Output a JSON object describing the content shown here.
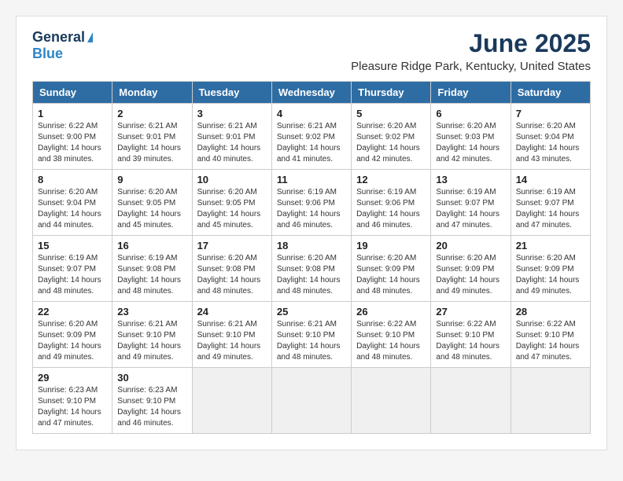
{
  "logo": {
    "general": "General",
    "blue": "Blue"
  },
  "title": "June 2025",
  "location": "Pleasure Ridge Park, Kentucky, United States",
  "days_of_week": [
    "Sunday",
    "Monday",
    "Tuesday",
    "Wednesday",
    "Thursday",
    "Friday",
    "Saturday"
  ],
  "weeks": [
    [
      {
        "day": "1",
        "sunrise": "6:22 AM",
        "sunset": "9:00 PM",
        "daylight": "14 hours and 38 minutes."
      },
      {
        "day": "2",
        "sunrise": "6:21 AM",
        "sunset": "9:01 PM",
        "daylight": "14 hours and 39 minutes."
      },
      {
        "day": "3",
        "sunrise": "6:21 AM",
        "sunset": "9:01 PM",
        "daylight": "14 hours and 40 minutes."
      },
      {
        "day": "4",
        "sunrise": "6:21 AM",
        "sunset": "9:02 PM",
        "daylight": "14 hours and 41 minutes."
      },
      {
        "day": "5",
        "sunrise": "6:20 AM",
        "sunset": "9:02 PM",
        "daylight": "14 hours and 42 minutes."
      },
      {
        "day": "6",
        "sunrise": "6:20 AM",
        "sunset": "9:03 PM",
        "daylight": "14 hours and 42 minutes."
      },
      {
        "day": "7",
        "sunrise": "6:20 AM",
        "sunset": "9:04 PM",
        "daylight": "14 hours and 43 minutes."
      }
    ],
    [
      {
        "day": "8",
        "sunrise": "6:20 AM",
        "sunset": "9:04 PM",
        "daylight": "14 hours and 44 minutes."
      },
      {
        "day": "9",
        "sunrise": "6:20 AM",
        "sunset": "9:05 PM",
        "daylight": "14 hours and 45 minutes."
      },
      {
        "day": "10",
        "sunrise": "6:20 AM",
        "sunset": "9:05 PM",
        "daylight": "14 hours and 45 minutes."
      },
      {
        "day": "11",
        "sunrise": "6:19 AM",
        "sunset": "9:06 PM",
        "daylight": "14 hours and 46 minutes."
      },
      {
        "day": "12",
        "sunrise": "6:19 AM",
        "sunset": "9:06 PM",
        "daylight": "14 hours and 46 minutes."
      },
      {
        "day": "13",
        "sunrise": "6:19 AM",
        "sunset": "9:07 PM",
        "daylight": "14 hours and 47 minutes."
      },
      {
        "day": "14",
        "sunrise": "6:19 AM",
        "sunset": "9:07 PM",
        "daylight": "14 hours and 47 minutes."
      }
    ],
    [
      {
        "day": "15",
        "sunrise": "6:19 AM",
        "sunset": "9:07 PM",
        "daylight": "14 hours and 48 minutes."
      },
      {
        "day": "16",
        "sunrise": "6:19 AM",
        "sunset": "9:08 PM",
        "daylight": "14 hours and 48 minutes."
      },
      {
        "day": "17",
        "sunrise": "6:20 AM",
        "sunset": "9:08 PM",
        "daylight": "14 hours and 48 minutes."
      },
      {
        "day": "18",
        "sunrise": "6:20 AM",
        "sunset": "9:08 PM",
        "daylight": "14 hours and 48 minutes."
      },
      {
        "day": "19",
        "sunrise": "6:20 AM",
        "sunset": "9:09 PM",
        "daylight": "14 hours and 48 minutes."
      },
      {
        "day": "20",
        "sunrise": "6:20 AM",
        "sunset": "9:09 PM",
        "daylight": "14 hours and 49 minutes."
      },
      {
        "day": "21",
        "sunrise": "6:20 AM",
        "sunset": "9:09 PM",
        "daylight": "14 hours and 49 minutes."
      }
    ],
    [
      {
        "day": "22",
        "sunrise": "6:20 AM",
        "sunset": "9:09 PM",
        "daylight": "14 hours and 49 minutes."
      },
      {
        "day": "23",
        "sunrise": "6:21 AM",
        "sunset": "9:10 PM",
        "daylight": "14 hours and 49 minutes."
      },
      {
        "day": "24",
        "sunrise": "6:21 AM",
        "sunset": "9:10 PM",
        "daylight": "14 hours and 49 minutes."
      },
      {
        "day": "25",
        "sunrise": "6:21 AM",
        "sunset": "9:10 PM",
        "daylight": "14 hours and 48 minutes."
      },
      {
        "day": "26",
        "sunrise": "6:22 AM",
        "sunset": "9:10 PM",
        "daylight": "14 hours and 48 minutes."
      },
      {
        "day": "27",
        "sunrise": "6:22 AM",
        "sunset": "9:10 PM",
        "daylight": "14 hours and 48 minutes."
      },
      {
        "day": "28",
        "sunrise": "6:22 AM",
        "sunset": "9:10 PM",
        "daylight": "14 hours and 47 minutes."
      }
    ],
    [
      {
        "day": "29",
        "sunrise": "6:23 AM",
        "sunset": "9:10 PM",
        "daylight": "14 hours and 47 minutes."
      },
      {
        "day": "30",
        "sunrise": "6:23 AM",
        "sunset": "9:10 PM",
        "daylight": "14 hours and 46 minutes."
      },
      null,
      null,
      null,
      null,
      null
    ]
  ]
}
